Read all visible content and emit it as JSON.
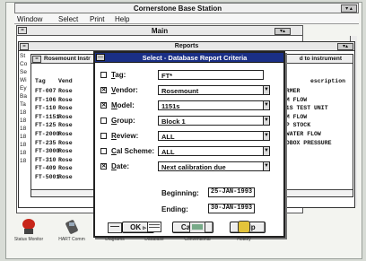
{
  "app": {
    "title": "Cornerstone Base Station",
    "sizebox": "▾ ▴"
  },
  "menu": [
    "Window",
    "Select",
    "Print",
    "Help"
  ],
  "main_window": {
    "title": "Main"
  },
  "reports_window": {
    "title": "Reports",
    "left_fragments": [
      "St",
      "Co",
      "Se",
      "Wi",
      "",
      "Ey",
      "Ba",
      "Ta",
      "18",
      "18",
      "18",
      "18",
      "18",
      "18",
      "18"
    ]
  },
  "list_window": {
    "title": "Rosemount Instr",
    "title_right": "d to instrument",
    "columns": {
      "tag": "Tag",
      "vendor": "Vend",
      "description": "escription"
    },
    "tags": [
      "FT-007",
      "FT-106",
      "FT-110",
      "FT-1151",
      "FT-125",
      "FT-2000",
      "FT-235",
      "FT-3000",
      "FT-310",
      "FT-409",
      "FT-5001"
    ],
    "vendors": [
      "Rose",
      "Rose",
      "Rose",
      "Rose",
      "Rose",
      "Rose",
      "Rose",
      "Rose",
      "Rose",
      "Rose",
      "Rose"
    ],
    "descriptions": [
      "FORMER",
      "EAM FLOW",
      "151S TEST UNIT",
      "EAM FLOW",
      "ULP STOCK",
      "",
      "",
      "EDWATER FLOW",
      "EADBOX PRESSURE",
      "",
      ""
    ]
  },
  "dialog": {
    "title": "Select - Database Report Criteria",
    "criteria": [
      {
        "label_u": "T",
        "label_rest": "ag:",
        "checked": false,
        "value": "FT*",
        "has_dropdown": false
      },
      {
        "label_u": "V",
        "label_rest": "endor:",
        "checked": true,
        "value": "Rosemount",
        "has_dropdown": true
      },
      {
        "label_u": "M",
        "label_rest": "odel:",
        "checked": true,
        "value": "1151s",
        "has_dropdown": true
      },
      {
        "label_u": "G",
        "label_rest": "roup:",
        "checked": false,
        "value": "Block 1",
        "has_dropdown": true
      },
      {
        "label_u": "R",
        "label_rest": "eview:",
        "checked": false,
        "value": "ALL",
        "has_dropdown": true
      },
      {
        "label_u": "C",
        "label_rest": "al Scheme:",
        "checked": false,
        "value": "ALL",
        "has_dropdown": true
      },
      {
        "label_u": "D",
        "label_rest": "ate:",
        "checked": true,
        "value": "Next calibration due",
        "has_dropdown": true
      }
    ],
    "beginning_label": "Beginning:",
    "beginning_value": "25-JAN-1993",
    "ending_label": "Ending:",
    "ending_value": "30-JAN-1993",
    "ok_label": "OK",
    "cancel_label": "Cancel",
    "help_label": "Help"
  },
  "tray": [
    {
      "label": "Status Monitor",
      "icon": "status-monitor-icon"
    },
    {
      "label": "HART Comm",
      "icon": "hart-comm-icon"
    },
    {
      "label": "Diagrams",
      "icon": "diagrams-icon"
    },
    {
      "label": "Database",
      "icon": "database-icon"
    },
    {
      "label": "Conventional",
      "icon": "conventional-icon"
    },
    {
      "label": "Hotkey",
      "icon": "hotkey-icon"
    }
  ],
  "colors": {
    "dialog_title_bg": "#1a2f86",
    "status_red": "#c8261a",
    "hotkey_yellow": "#e3c33a"
  }
}
